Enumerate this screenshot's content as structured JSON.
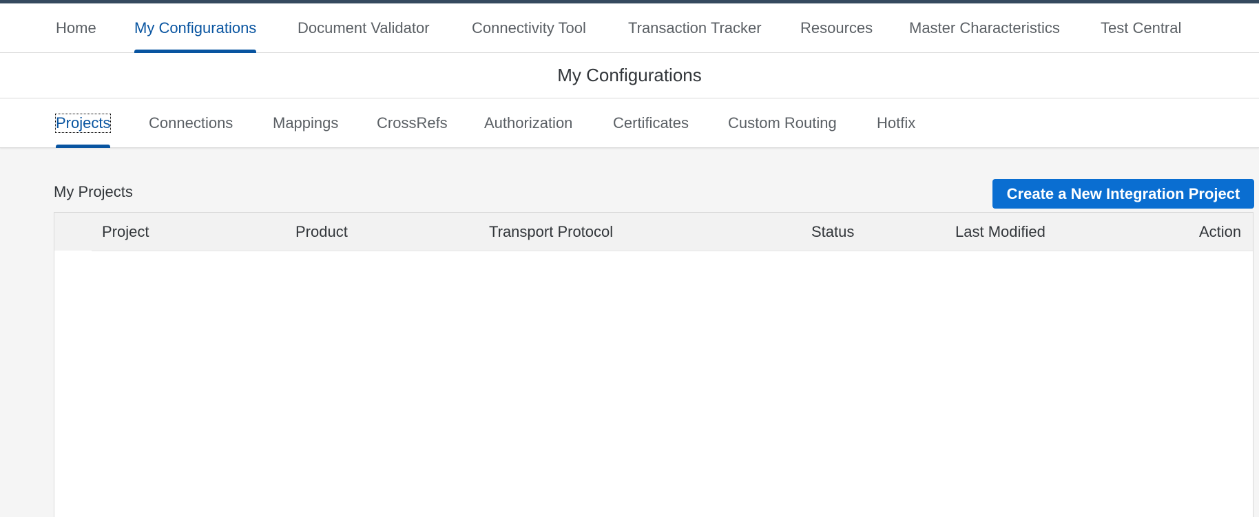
{
  "main_nav": {
    "items": [
      {
        "label": "Home"
      },
      {
        "label": "My Configurations"
      },
      {
        "label": "Document Validator"
      },
      {
        "label": "Connectivity Tool"
      },
      {
        "label": "Transaction Tracker"
      },
      {
        "label": "Resources"
      },
      {
        "label": "Master Characteristics"
      },
      {
        "label": "Test Central"
      }
    ],
    "active": "My Configurations"
  },
  "page": {
    "title": "My Configurations"
  },
  "sub_tabs": {
    "items": [
      {
        "label": "Projects"
      },
      {
        "label": "Connections"
      },
      {
        "label": "Mappings"
      },
      {
        "label": "CrossRefs"
      },
      {
        "label": "Authorization"
      },
      {
        "label": "Certificates"
      },
      {
        "label": "Custom Routing"
      },
      {
        "label": "Hotfix"
      }
    ],
    "active": "Projects"
  },
  "projects": {
    "section_title": "My Projects",
    "create_button_label": "Create a New Integration Project",
    "columns": [
      "Project",
      "Product",
      "Transport Protocol",
      "Status",
      "Last Modified",
      "Action"
    ],
    "rows": []
  },
  "colors": {
    "accent": "#0854a0",
    "button": "#0a6ed1",
    "top_stripe": "#354a5f",
    "background": "#f5f5f5"
  }
}
